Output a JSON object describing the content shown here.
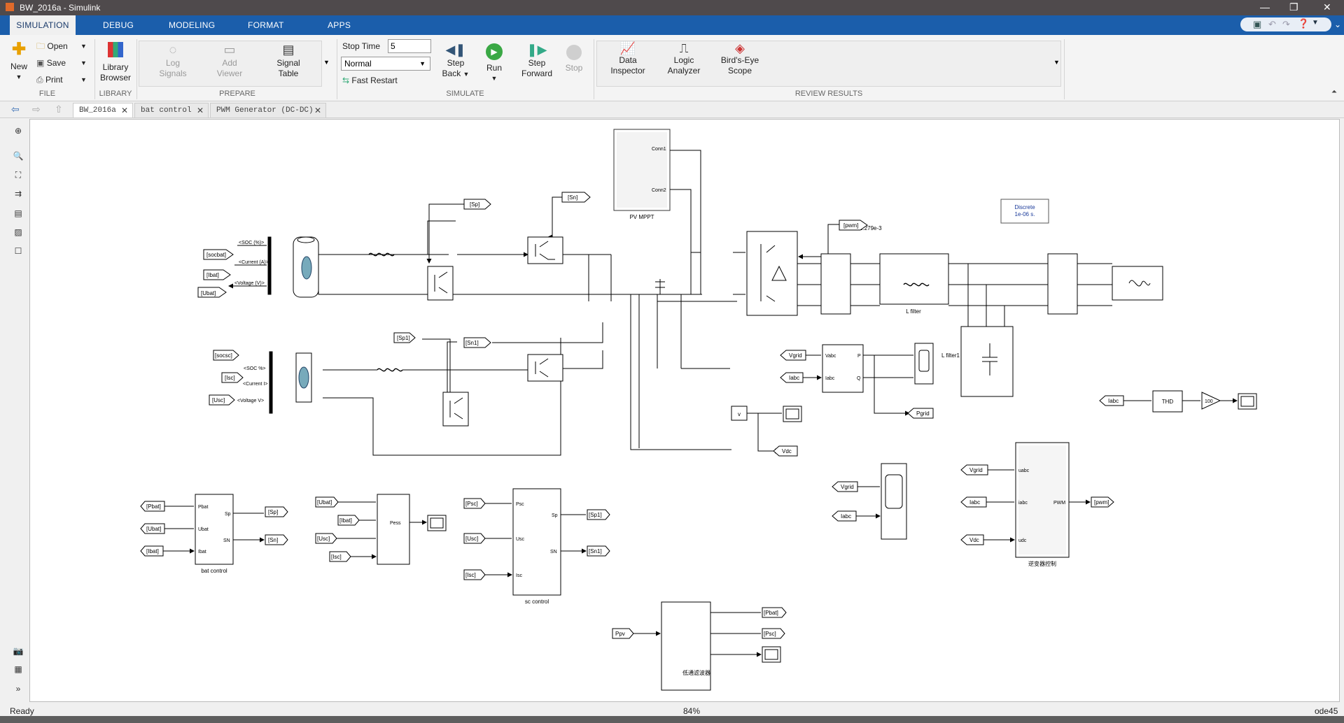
{
  "window": {
    "title": "BW_2016a - Simulink"
  },
  "ribbon_tabs": [
    {
      "label": "SIMULATION"
    },
    {
      "label": "DEBUG"
    },
    {
      "label": "MODELING"
    },
    {
      "label": "FORMAT"
    },
    {
      "label": "APPS"
    }
  ],
  "file_group": {
    "new": "New",
    "open": "Open",
    "save": "Save",
    "print": "Print",
    "label": "FILE"
  },
  "library_group": {
    "line1": "Library",
    "line2": "Browser",
    "label": "LIBRARY"
  },
  "prepare_group": {
    "log1": "Log",
    "log2": "Signals",
    "add1": "Add",
    "add2": "Viewer",
    "sig1": "Signal",
    "sig2": "Table",
    "label": "PREPARE"
  },
  "simulate_group": {
    "stop_time_label": "Stop Time",
    "stop_time_value": "5",
    "mode": "Normal",
    "fast_restart": "Fast Restart",
    "step_back1": "Step",
    "step_back2": "Back",
    "run": "Run",
    "step_fwd1": "Step",
    "step_fwd2": "Forward",
    "stop": "Stop",
    "label": "SIMULATE"
  },
  "review_group": {
    "di1": "Data",
    "di2": "Inspector",
    "la1": "Logic",
    "la2": "Analyzer",
    "be1": "Bird's-Eye",
    "be2": "Scope",
    "label": "REVIEW RESULTS"
  },
  "doc_tabs": [
    {
      "label": "BW_2016a"
    },
    {
      "label": "bat control"
    },
    {
      "label": "PWM Generator (DC-DC)"
    }
  ],
  "status": {
    "left": "Ready",
    "zoom": "84%",
    "solver": "ode45"
  },
  "diagram": {
    "pv_mppt": "PV MPPT",
    "conn1": "Conn1",
    "conn2": "Conn2",
    "discrete1": "Discrete",
    "discrete2": "1e-06 s.",
    "const_val": "1.279e-3",
    "tag_sp": "[Sp]",
    "tag_sn": "[Sn]",
    "tag_sp1": "[Sp1]",
    "tag_sn1": "[Sn1]",
    "tag_pwm": "[pwm]",
    "tag_socbat": "[socbat]",
    "tag_ibat": "[Ibat]",
    "tag_ubat": "[Ubat]",
    "soc_pct": "<SOC (%)>",
    "current_a": "<Current (A)>",
    "voltage_v": "<Voltage (V)>",
    "tag_socsc": "[socsc]",
    "tag_isc": "[Isc]",
    "tag_usc": "[Usc]",
    "soc_pct2": "<SOC %>",
    "current_i": "<Current I>",
    "voltage_v2": "<Voltage V>",
    "l_filter": "L filter",
    "l_filter1": "L filter1",
    "vgrid": "Vgrid",
    "iabc": "Iabc",
    "vabc": "Vabc",
    "p": "P",
    "q": "Q",
    "pgrid": "Pgrid",
    "vdc": "Vdc",
    "v": "v",
    "thd": "THD",
    "k100": "100",
    "bat_control": "bat control",
    "sc_control": "sc control",
    "inv_ctrl": "逆变器控制",
    "lpf": "低通滤波器",
    "pbat": "[Pbat]",
    "ubat": "[Ubat]",
    "ibat": "[Ibat]",
    "psc": "[Psc]",
    "usc": "[Usc]",
    "isc": "[Isc]",
    "ppv": "Ppv",
    "uabc": "uabc",
    "iabc_in": "iabc",
    "udc": "udc",
    "pwm": "PWM",
    "pess": "Pess"
  }
}
